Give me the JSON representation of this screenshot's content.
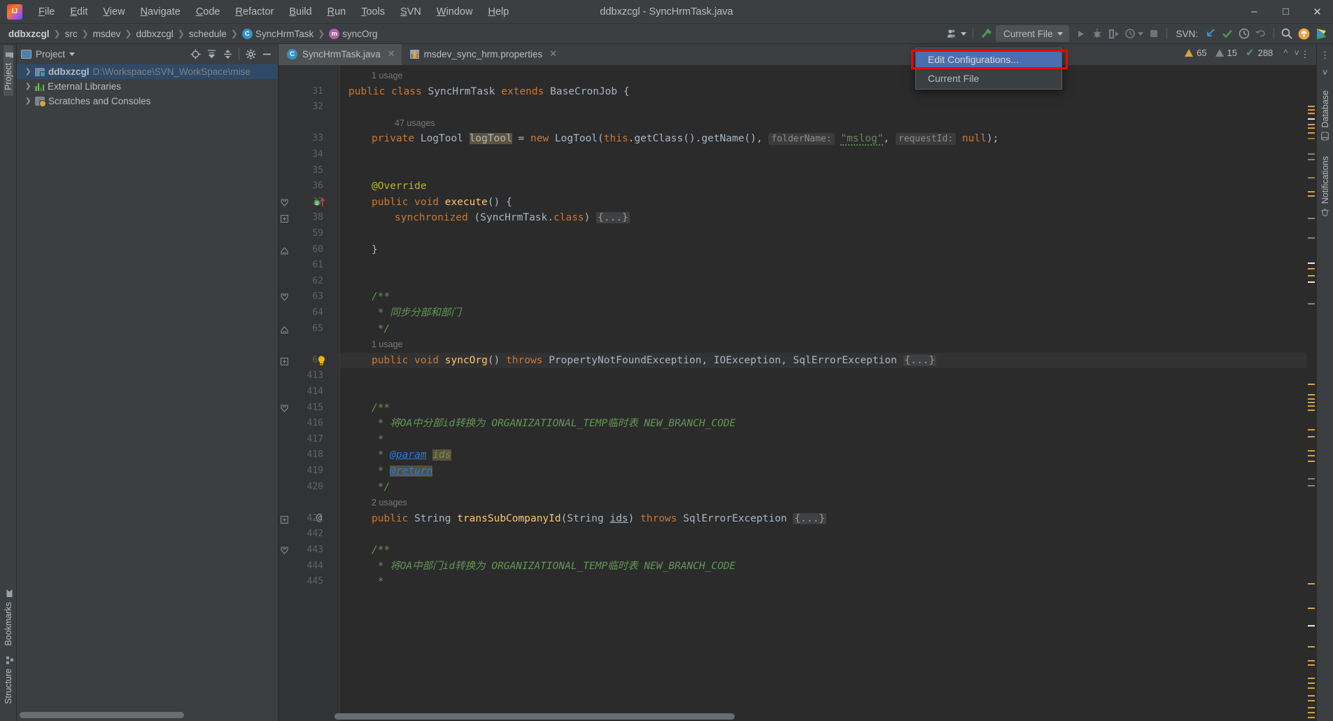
{
  "window": {
    "title": "ddbxzcgl - SyncHrmTask.java",
    "logo": "intellij-idea-logo",
    "controls": [
      "minimize",
      "maximize",
      "close"
    ]
  },
  "menu": [
    {
      "label": "File",
      "mnemonic": "F"
    },
    {
      "label": "Edit",
      "mnemonic": "E"
    },
    {
      "label": "View",
      "mnemonic": "V"
    },
    {
      "label": "Navigate",
      "mnemonic": "N"
    },
    {
      "label": "Code",
      "mnemonic": "C"
    },
    {
      "label": "Refactor",
      "mnemonic": "R"
    },
    {
      "label": "Build",
      "mnemonic": "B"
    },
    {
      "label": "Run",
      "mnemonic": "R"
    },
    {
      "label": "Tools",
      "mnemonic": "T"
    },
    {
      "label": "SVN",
      "mnemonic": "S"
    },
    {
      "label": "Window",
      "mnemonic": "W"
    },
    {
      "label": "Help",
      "mnemonic": "H"
    }
  ],
  "breadcrumbs": [
    {
      "label": "ddbxzcgl",
      "bold": true,
      "badge": ""
    },
    {
      "label": "src",
      "bold": false,
      "badge": ""
    },
    {
      "label": "msdev",
      "bold": false,
      "badge": ""
    },
    {
      "label": "ddbxzcgl",
      "bold": false,
      "badge": ""
    },
    {
      "label": "schedule",
      "bold": false,
      "badge": ""
    },
    {
      "label": "SyncHrmTask",
      "bold": false,
      "badge": "C"
    },
    {
      "label": "syncOrg",
      "bold": false,
      "badge": "m"
    }
  ],
  "toolbar": {
    "run_config_label": "Current File",
    "svn_label": "SVN:",
    "icons": [
      "users-icon",
      "hammer-icon",
      "run-icon",
      "debug-icon",
      "run-coverage-icon",
      "profiler-icon",
      "stop-icon",
      "svn-update-icon",
      "svn-commit-icon",
      "svn-history-icon",
      "svn-rollback-icon",
      "search-everywhere-icon",
      "update-icon"
    ]
  },
  "run_popup": {
    "items": [
      {
        "label": "Edit Configurations...",
        "selected": true,
        "highlighted": true
      },
      {
        "label": "Current File",
        "selected": false,
        "highlighted": false
      }
    ],
    "highlight_color": "#ff0000",
    "selection_color": "#4b6eaf"
  },
  "left_strip": {
    "top_label": "Project",
    "bottom_labels": [
      "Bookmarks",
      "Structure"
    ]
  },
  "right_strip": {
    "labels": [
      "Database",
      "Notifications"
    ]
  },
  "project_panel": {
    "title": "Project",
    "header_icons": [
      "locate-icon",
      "expand-all-icon",
      "collapse-all-icon",
      "settings-gear-icon",
      "hide-icon"
    ],
    "tree": [
      {
        "label": "ddbxzcgl",
        "path": "D:\\Workspace\\SVN_WorkSpace\\mise",
        "icon": "module-folder-icon",
        "selected": true,
        "expandable": true
      },
      {
        "label": "External Libraries",
        "path": "",
        "icon": "libraries-icon",
        "selected": false,
        "expandable": true
      },
      {
        "label": "Scratches and Consoles",
        "path": "",
        "icon": "scratches-icon",
        "selected": false,
        "expandable": true
      }
    ]
  },
  "editor": {
    "tabs": [
      {
        "label": "SyncHrmTask.java",
        "icon": "java-class-icon",
        "active": true
      },
      {
        "label": "msdev_sync_hrm.properties",
        "icon": "properties-file-icon",
        "active": false
      }
    ],
    "more_tabs_icon": "more-vertical-icon",
    "inspections": {
      "warnings": "65",
      "weak_warnings": "15",
      "typos": "288",
      "up_icon": "chevron-up-icon",
      "down_icon": "chevron-down-icon"
    },
    "lines": [
      {
        "num": "",
        "gutter": "",
        "fold": "",
        "indent": 1,
        "segs": [
          {
            "t": "1 usage",
            "c": "usage"
          }
        ]
      },
      {
        "num": "31",
        "gutter": "",
        "fold": "",
        "indent": 0,
        "segs": [
          {
            "t": "public ",
            "c": "kw"
          },
          {
            "t": "class ",
            "c": "kw"
          },
          {
            "t": "SyncHrmTask ",
            "c": "cls"
          },
          {
            "t": "extends ",
            "c": "kw"
          },
          {
            "t": "BaseCronJob",
            "c": "typ"
          },
          {
            "t": " {",
            "c": ""
          }
        ]
      },
      {
        "num": "32",
        "gutter": "",
        "fold": "",
        "indent": 0,
        "segs": []
      },
      {
        "num": "",
        "gutter": "",
        "fold": "",
        "indent": 2,
        "segs": [
          {
            "t": "47 usages",
            "c": "usage"
          }
        ]
      },
      {
        "num": "33",
        "gutter": "",
        "fold": "",
        "indent": 1,
        "segs": [
          {
            "t": "private ",
            "c": "kw"
          },
          {
            "t": "LogTool ",
            "c": "typ"
          },
          {
            "t": "logTool",
            "c": "hlbg"
          },
          {
            "t": " = ",
            "c": ""
          },
          {
            "t": "new ",
            "c": "kw"
          },
          {
            "t": "LogTool(",
            "c": "typ"
          },
          {
            "t": "this",
            "c": "kw"
          },
          {
            "t": ".getClass().getName(), ",
            "c": ""
          },
          {
            "t": "folderName:",
            "c": "hint"
          },
          {
            "t": " ",
            "c": ""
          },
          {
            "t": "\"mslog\"",
            "c": "str"
          },
          {
            "t": ", ",
            "c": ""
          },
          {
            "t": "requestId:",
            "c": "hint"
          },
          {
            "t": " ",
            "c": ""
          },
          {
            "t": "null",
            "c": "kw"
          },
          {
            "t": ");",
            "c": ""
          }
        ]
      },
      {
        "num": "34",
        "gutter": "",
        "fold": "",
        "indent": 0,
        "segs": []
      },
      {
        "num": "35",
        "gutter": "",
        "fold": "",
        "indent": 0,
        "segs": []
      },
      {
        "num": "36",
        "gutter": "",
        "fold": "",
        "indent": 1,
        "segs": [
          {
            "t": "@Override",
            "c": "anno"
          }
        ]
      },
      {
        "num": "37",
        "gutter": "override-marker",
        "fold": "fold-open",
        "indent": 1,
        "segs": [
          {
            "t": "public ",
            "c": "kw"
          },
          {
            "t": "void ",
            "c": "kw"
          },
          {
            "t": "execute",
            "c": "fn"
          },
          {
            "t": "() {",
            "c": ""
          }
        ]
      },
      {
        "num": "38",
        "gutter": "",
        "fold": "fold-plus",
        "indent": 2,
        "segs": [
          {
            "t": "synchronized ",
            "c": "kw"
          },
          {
            "t": "(SyncHrmTask.",
            "c": ""
          },
          {
            "t": "class",
            "c": "kw"
          },
          {
            "t": ") ",
            "c": ""
          },
          {
            "t": "{...}",
            "c": "fold"
          }
        ]
      },
      {
        "num": "59",
        "gutter": "",
        "fold": "",
        "indent": 0,
        "segs": []
      },
      {
        "num": "60",
        "gutter": "",
        "fold": "fold-end",
        "indent": 1,
        "segs": [
          {
            "t": "}",
            "c": ""
          }
        ]
      },
      {
        "num": "61",
        "gutter": "",
        "fold": "",
        "indent": 0,
        "segs": []
      },
      {
        "num": "62",
        "gutter": "",
        "fold": "",
        "indent": 0,
        "segs": []
      },
      {
        "num": "63",
        "gutter": "",
        "fold": "fold-open",
        "indent": 1,
        "segs": [
          {
            "t": "/**",
            "c": "cmt"
          }
        ]
      },
      {
        "num": "64",
        "gutter": "",
        "fold": "",
        "indent": 1,
        "segs": [
          {
            "t": " * 同步分部和部门",
            "c": "cmt"
          }
        ]
      },
      {
        "num": "65",
        "gutter": "",
        "fold": "fold-end",
        "indent": 1,
        "segs": [
          {
            "t": " */",
            "c": "cmt"
          }
        ]
      },
      {
        "num": "",
        "gutter": "",
        "fold": "",
        "indent": 1,
        "segs": [
          {
            "t": "1 usage",
            "c": "usage"
          }
        ]
      },
      {
        "num": "66",
        "gutter": "intention-bulb",
        "fold": "fold-plus",
        "indent": 1,
        "segs": [
          {
            "t": "public ",
            "c": "kw"
          },
          {
            "t": "void ",
            "c": "kw"
          },
          {
            "t": "syncOrg",
            "c": "fn"
          },
          {
            "t": "() ",
            "c": ""
          },
          {
            "t": "throws ",
            "c": "kw"
          },
          {
            "t": "PropertyNotFoundException",
            "c": "typ"
          },
          {
            "t": ", ",
            "c": ""
          },
          {
            "t": "IOException",
            "c": "typ"
          },
          {
            "t": ", ",
            "c": ""
          },
          {
            "t": "SqlErrorException ",
            "c": "typ"
          },
          {
            "t": "{...}",
            "c": "fold"
          }
        ]
      },
      {
        "num": "413",
        "gutter": "",
        "fold": "",
        "indent": 0,
        "segs": []
      },
      {
        "num": "414",
        "gutter": "",
        "fold": "",
        "indent": 0,
        "segs": []
      },
      {
        "num": "415",
        "gutter": "",
        "fold": "fold-open",
        "indent": 1,
        "segs": [
          {
            "t": "/**",
            "c": "cmt"
          }
        ]
      },
      {
        "num": "416",
        "gutter": "",
        "fold": "",
        "indent": 1,
        "segs": [
          {
            "t": " * 将OA中分部id转换为 ORGANIZATIONAL_TEMP临时表 NEW_BRANCH_CODE",
            "c": "cmt"
          }
        ]
      },
      {
        "num": "417",
        "gutter": "",
        "fold": "",
        "indent": 1,
        "segs": [
          {
            "t": " *",
            "c": "cmt"
          }
        ]
      },
      {
        "num": "418",
        "gutter": "",
        "fold": "",
        "indent": 1,
        "segs": [
          {
            "t": " * ",
            "c": "cmt"
          },
          {
            "t": "@param",
            "c": "cmt-tag"
          },
          {
            "t": " ",
            "c": "cmt"
          },
          {
            "t": "ids",
            "c": "cmt-param"
          }
        ]
      },
      {
        "num": "419",
        "gutter": "",
        "fold": "",
        "indent": 1,
        "segs": [
          {
            "t": " * ",
            "c": "cmt"
          },
          {
            "t": "@return",
            "c": "cmt-tag2"
          }
        ]
      },
      {
        "num": "420",
        "gutter": "",
        "fold": "",
        "indent": 1,
        "segs": [
          {
            "t": " */",
            "c": "cmt"
          }
        ]
      },
      {
        "num": "",
        "gutter": "",
        "fold": "",
        "indent": 1,
        "segs": [
          {
            "t": "2 usages",
            "c": "usage"
          }
        ]
      },
      {
        "num": "421",
        "gutter": "override-at",
        "fold": "fold-plus",
        "indent": 1,
        "segs": [
          {
            "t": "public ",
            "c": "kw"
          },
          {
            "t": "String ",
            "c": "typ"
          },
          {
            "t": "transSubCompanyId",
            "c": "fn"
          },
          {
            "t": "(String ",
            "c": "typ"
          },
          {
            "t": "ids",
            "c": "underline"
          },
          {
            "t": ") ",
            "c": ""
          },
          {
            "t": "throws ",
            "c": "kw"
          },
          {
            "t": "SqlErrorException ",
            "c": "typ"
          },
          {
            "t": "{...}",
            "c": "fold"
          }
        ]
      },
      {
        "num": "442",
        "gutter": "",
        "fold": "",
        "indent": 0,
        "segs": []
      },
      {
        "num": "443",
        "gutter": "",
        "fold": "fold-open",
        "indent": 1,
        "segs": [
          {
            "t": "/**",
            "c": "cmt"
          }
        ]
      },
      {
        "num": "444",
        "gutter": "",
        "fold": "",
        "indent": 1,
        "segs": [
          {
            "t": " * 将OA中部门id转换为 ORGANIZATIONAL_TEMP临时表 NEW_BRANCH_CODE",
            "c": "cmt"
          }
        ]
      },
      {
        "num": "445",
        "gutter": "",
        "fold": "",
        "indent": 1,
        "segs": [
          {
            "t": " *",
            "c": "cmt"
          }
        ]
      }
    ]
  },
  "colors": {
    "background": "#2b2b2b",
    "panel": "#3c3f41",
    "selection": "#4b6eaf",
    "keyword": "#cc7832",
    "string": "#6a8759",
    "comment": "#629755",
    "method": "#ffc66d",
    "annotation": "#bbb529",
    "accent_red": "#ff0000",
    "warning": "#d6a243"
  }
}
